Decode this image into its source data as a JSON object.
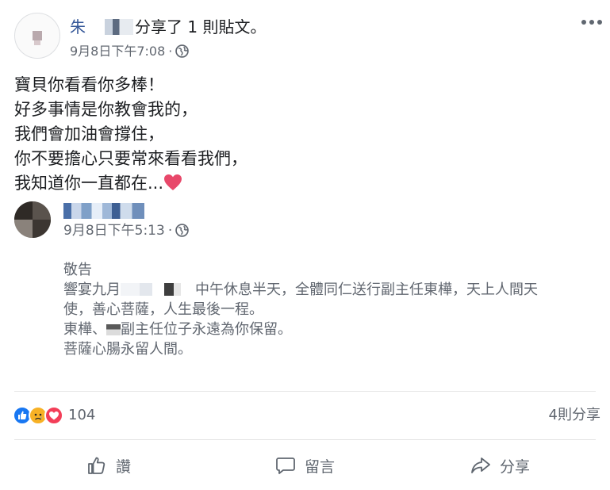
{
  "header": {
    "author_name": "朱",
    "share_text": "分享了 1 則貼文。",
    "timestamp": "9月8日下午7:08",
    "separator": "·",
    "privacy_icon": "globe-icon",
    "more_icon": "more-icon"
  },
  "post_lines": [
    "寶貝你看看你多棒！",
    "好多事情是你教會我的，",
    "我們會加油會撐住，",
    "你不要擔心只要常來看看我們，",
    "我知道你一直都在..."
  ],
  "shared_post": {
    "timestamp": "9月8日下午5:13",
    "separator": "·",
    "notice_title": "敬告",
    "line1_prefix": "響宴九月",
    "line1_suffix": "中午休息半天，全體同仁送行副主任東樺，天上人間天",
    "line2": "使，善心菩薩，人生最後一程。",
    "line3_prefix": "東樺、",
    "line3_suffix": "副主任位子永遠為你保留。",
    "line4": "菩薩心腸永留人間。"
  },
  "reactions": {
    "icons": [
      "like-icon",
      "sad-icon",
      "love-icon"
    ],
    "count": "104",
    "shares": "4則分享",
    "colors": {
      "like": "#1877f2",
      "sad": "#f7b125",
      "love": "#f33e58"
    }
  },
  "actions": {
    "like_label": "讚",
    "comment_label": "留言",
    "share_label": "分享"
  }
}
